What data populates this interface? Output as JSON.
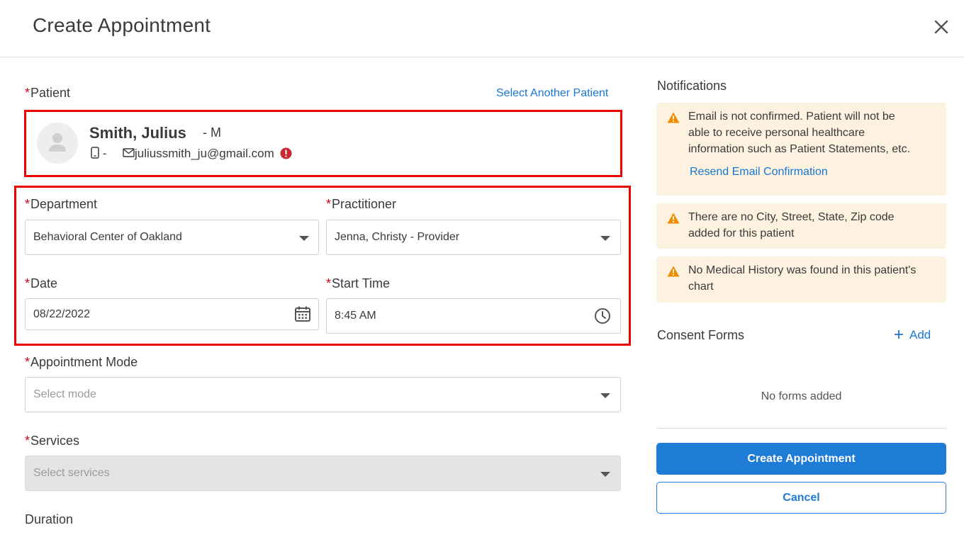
{
  "header": {
    "title": "Create Appointment"
  },
  "patient": {
    "label": "Patient",
    "select_another": "Select Another Patient",
    "name": "Smith, Julius",
    "sex": "- M",
    "phone": "-",
    "email": "juliussmith_ju@gmail.com"
  },
  "form": {
    "department": {
      "label": "Department",
      "value": "Behavioral Center of Oakland"
    },
    "practitioner": {
      "label": "Practitioner",
      "value": "Jenna, Christy - Provider"
    },
    "date": {
      "label": "Date",
      "value": "08/22/2022"
    },
    "start_time": {
      "label": "Start Time",
      "value": "8:45 AM"
    },
    "appointment_mode": {
      "label": "Appointment Mode",
      "placeholder": "Select mode"
    },
    "services": {
      "label": "Services",
      "placeholder": "Select services"
    },
    "duration": {
      "label": "Duration"
    }
  },
  "notifications": {
    "title": "Notifications",
    "items": [
      {
        "text_lines": [
          "Email is not confirmed. Patient will not be",
          "able to receive personal healthcare",
          "information such as Patient Statements, etc."
        ],
        "action": "Resend Email Confirmation"
      },
      {
        "text_lines": [
          "There are no City, Street, State, Zip code",
          "added for this patient"
        ]
      },
      {
        "text_lines": [
          "No Medical History was found in this patient's",
          "chart"
        ]
      }
    ]
  },
  "consent": {
    "title": "Consent Forms",
    "add_label": "Add",
    "empty_text": "No forms added"
  },
  "actions": {
    "create": "Create Appointment",
    "cancel": "Cancel"
  },
  "colors": {
    "accent": "#1e7bd6",
    "required": "#d0021b",
    "warning": "#f08c00",
    "notice_bg": "#fdf1df",
    "highlight": "#ee0000",
    "error_badge": "#c62834"
  },
  "icons": {
    "close": "close-icon",
    "avatar": "user-icon",
    "phone": "phone-icon",
    "email": "mail-icon",
    "email_error": "error-icon",
    "calendar": "calendar-icon",
    "clock": "clock-icon",
    "warning": "warning-icon",
    "add": "plus-icon"
  }
}
